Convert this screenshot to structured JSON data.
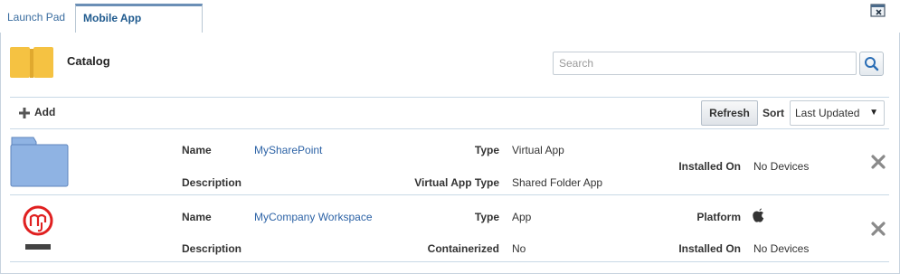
{
  "tabs": [
    {
      "label": "Launch Pad",
      "active": false
    },
    {
      "label": "Mobile App Catalog",
      "active": true,
      "close": "×"
    }
  ],
  "header": {
    "title": "Catalog"
  },
  "search": {
    "placeholder": "Search",
    "value": ""
  },
  "toolbar": {
    "add_label": "Add",
    "refresh_label": "Refresh",
    "sort_label": "Sort",
    "sort_value": "Last Updated",
    "sort_arrow": "▼"
  },
  "apps": [
    {
      "icon": "folder-icon",
      "name_label": "Name",
      "name": "MySharePoint",
      "description_label": "Description",
      "description": "",
      "type_label": "Type",
      "type": "Virtual App",
      "subtype_label": "Virtual App Type",
      "subtype": "Shared Folder App",
      "installed_label": "Installed On",
      "installed": "No Devices"
    },
    {
      "icon": "mycompany-logo-icon",
      "name_label": "Name",
      "name": "MyCompany Workspace",
      "description_label": "Description",
      "description": "",
      "type_label": "Type",
      "type": "App",
      "containerized_label": "Containerized",
      "containerized": "No",
      "platform_label": "Platform",
      "platform_icon": "apple-icon",
      "installed_label": "Installed On",
      "installed": "No Devices"
    }
  ],
  "colors": {
    "accent": "#2d63a6",
    "folder": "#8fb3e3",
    "catalog_icon": "#f5c242",
    "logo_red": "#e02020"
  }
}
